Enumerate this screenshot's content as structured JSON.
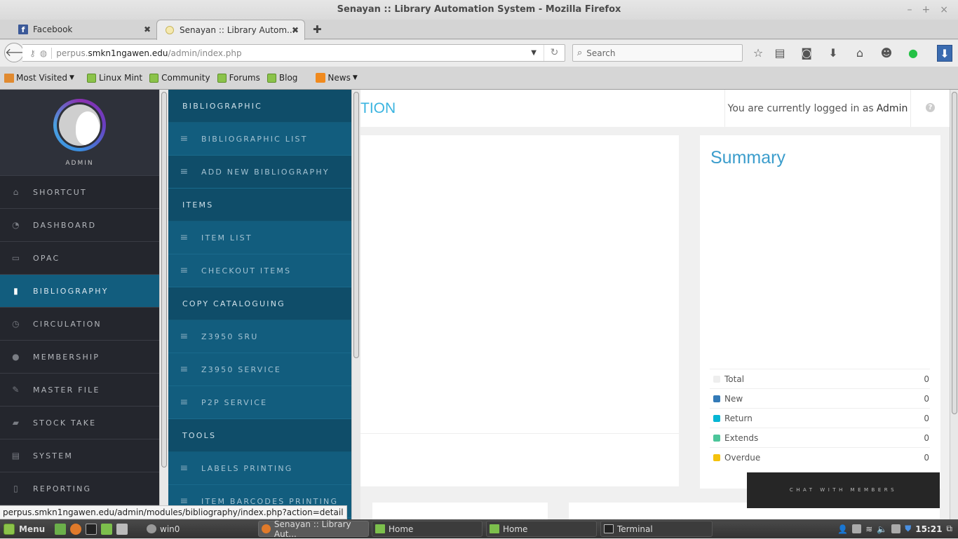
{
  "window": {
    "title": "Senayan :: Library Automation System - Mozilla Firefox",
    "controls": [
      "–",
      "+",
      "×"
    ]
  },
  "tabs": [
    {
      "label": "Facebook",
      "icon": "facebook-icon",
      "active": false
    },
    {
      "label": "Senayan :: Library Autom...",
      "icon": "senayan-icon",
      "active": true
    }
  ],
  "navbar": {
    "url_prefix": "perpus.",
    "url_host": "smkn1ngawen.edu",
    "url_path": "/admin/index.php",
    "search_placeholder": "Search",
    "toolbar_icons": [
      "bookmark-star-icon",
      "reading-list-icon",
      "pocket-icon",
      "downloads-icon",
      "home-icon",
      "chat-icon",
      "whatsapp-icon",
      "download-addon-icon"
    ]
  },
  "bookmarks": [
    {
      "label": "Most Visited",
      "icon": "folder-icon",
      "dropdown": true
    },
    {
      "label": "Linux Mint",
      "icon": "mint-icon"
    },
    {
      "label": "Community",
      "icon": "mint-icon"
    },
    {
      "label": "Forums",
      "icon": "mint-icon"
    },
    {
      "label": "Blog",
      "icon": "mint-icon"
    },
    {
      "label": "News",
      "icon": "rss-icon",
      "dropdown": true
    }
  ],
  "sidebar": {
    "user": "ADMIN",
    "items": [
      {
        "label": "SHORTCUT",
        "icon": "home-icon",
        "glyph": "⌂"
      },
      {
        "label": "DASHBOARD",
        "icon": "dashboard-icon",
        "glyph": "◔"
      },
      {
        "label": "OPAC",
        "icon": "monitor-icon",
        "glyph": "▭"
      },
      {
        "label": "BIBLIOGRAPHY",
        "icon": "bookmark-icon",
        "glyph": "▮",
        "active": true
      },
      {
        "label": "CIRCULATION",
        "icon": "clock-icon",
        "glyph": "◷"
      },
      {
        "label": "MEMBERSHIP",
        "icon": "user-icon",
        "glyph": "●"
      },
      {
        "label": "MASTER FILE",
        "icon": "pencil-icon",
        "glyph": "✎"
      },
      {
        "label": "STOCK TAKE",
        "icon": "briefcase-icon",
        "glyph": "▰"
      },
      {
        "label": "SYSTEM",
        "icon": "keyboard-icon",
        "glyph": "▤"
      },
      {
        "label": "REPORTING",
        "icon": "document-icon",
        "glyph": "▯"
      }
    ]
  },
  "submenu": [
    {
      "type": "header",
      "label": "BIBLIOGRAPHIC"
    },
    {
      "type": "item",
      "label": "BIBLIOGRAPHIC LIST"
    },
    {
      "type": "item",
      "label": "ADD NEW BIBLIOGRAPHY",
      "dark": true
    },
    {
      "type": "header",
      "label": "ITEMS"
    },
    {
      "type": "item",
      "label": "ITEM LIST"
    },
    {
      "type": "item",
      "label": "CHECKOUT ITEMS"
    },
    {
      "type": "header",
      "label": "COPY CATALOGUING"
    },
    {
      "type": "item",
      "label": "Z3950 SRU"
    },
    {
      "type": "item",
      "label": "Z3950 SERVICE"
    },
    {
      "type": "item",
      "label": "P2P SERVICE"
    },
    {
      "type": "header",
      "label": "TOOLS"
    },
    {
      "type": "item",
      "label": "LABELS PRINTING"
    },
    {
      "type": "item",
      "label": "ITEM BARCODES PRINTING"
    }
  ],
  "content": {
    "page_title": "TION",
    "login_text": "You are currently logged in as",
    "login_user": "Admin",
    "help_glyph": "?",
    "summary": {
      "title": "Summary",
      "rows": [
        {
          "label": "Total",
          "value": "0",
          "color": "#eeeeee"
        },
        {
          "label": "New",
          "value": "0",
          "color": "#337ab7"
        },
        {
          "label": "Return",
          "value": "0",
          "color": "#06b6d4"
        },
        {
          "label": "Extends",
          "value": "0",
          "color": "#4cc59a"
        },
        {
          "label": "Overdue",
          "value": "0",
          "color": "#f4c20d"
        }
      ]
    },
    "chat_label": "CHAT WITH MEMBERS"
  },
  "status_link": "perpus.smkn1ngawen.edu/admin/modules/bibliography/index.php?action=detail",
  "taskbar": {
    "menu_label": "Menu",
    "windows": [
      {
        "label": "win0",
        "icon": "gear-icon"
      },
      {
        "label": "Senayan :: Library Aut...",
        "icon": "firefox-icon",
        "active": true
      },
      {
        "label": "Home",
        "icon": "folder-icon"
      },
      {
        "label": "Home",
        "icon": "folder-icon"
      },
      {
        "label": "Terminal",
        "icon": "terminal-icon"
      }
    ],
    "clock": "15:21"
  }
}
